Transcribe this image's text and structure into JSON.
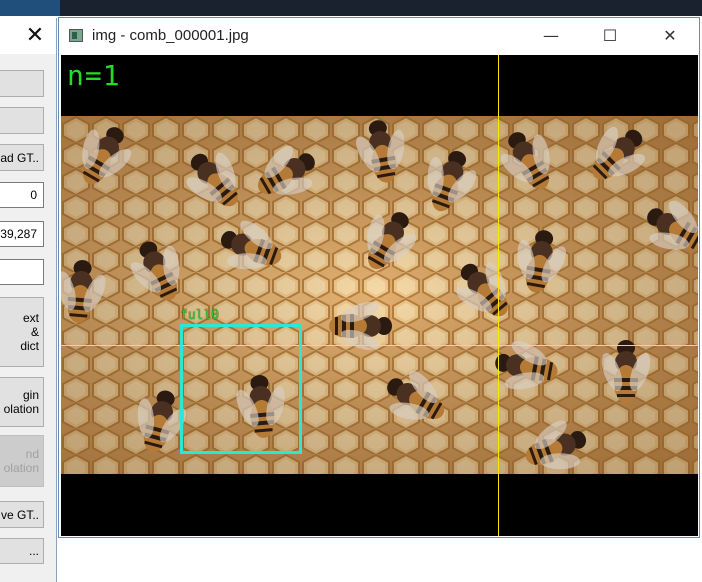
{
  "image_window": {
    "title": "img - comb_000001.jpg",
    "minimize_glyph": "—",
    "maximize_glyph": "☐",
    "close_glyph": "✕",
    "overlay": {
      "count_text": "n=1",
      "box_label": "full0",
      "box_color": "#2ee6d6",
      "crosshair_color": "#ffe600",
      "label_color": "#22dd22"
    }
  },
  "control_panel": {
    "close_glyph": "✕",
    "buttons": [
      {
        "label": ""
      },
      {
        "label": ""
      },
      {
        "label": "ad GT.."
      },
      {
        "label": "ext\n&\ndict"
      },
      {
        "label": "gin\nolation"
      },
      {
        "label": "nd\nolation"
      },
      {
        "label": "ve GT.."
      },
      {
        "label": "..."
      }
    ],
    "fields": [
      {
        "value": "0"
      },
      {
        "value": "39,287"
      },
      {
        "value": ""
      }
    ]
  }
}
